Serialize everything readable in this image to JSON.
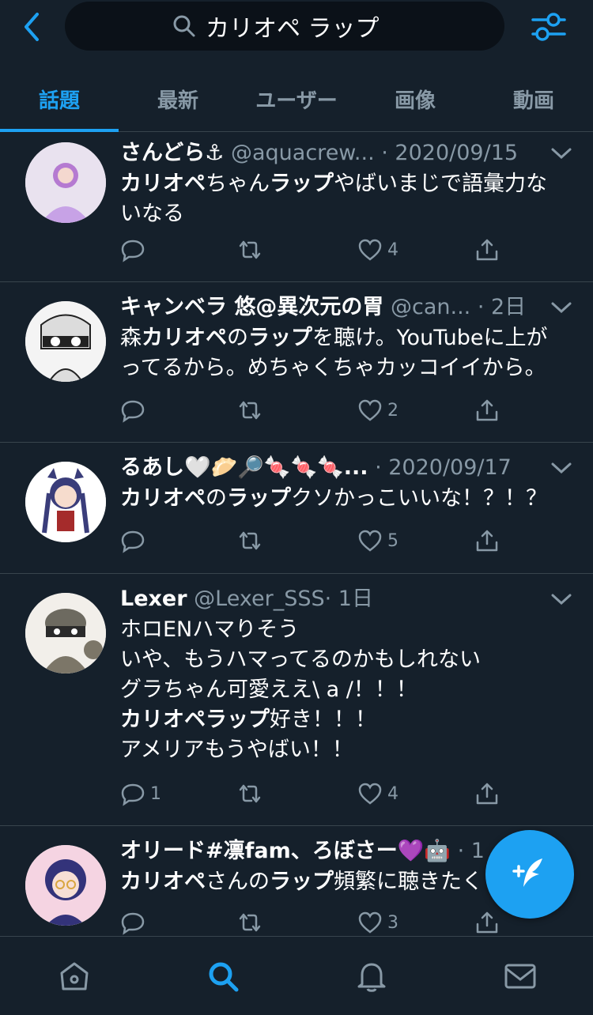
{
  "search": {
    "query": "カリオペ ラップ"
  },
  "tabs": [
    {
      "label": "話題",
      "active": true
    },
    {
      "label": "最新",
      "active": false
    },
    {
      "label": "ユーザー",
      "active": false
    },
    {
      "label": "画像",
      "active": false
    },
    {
      "label": "動画",
      "active": false
    }
  ],
  "tweets": [
    {
      "name": "さんどら⚓",
      "handle": "@aquacrew...",
      "date": "· 2020/09/15",
      "lines": [
        [
          {
            "b": "カリオペ"
          },
          {
            "t": "ちゃん"
          },
          {
            "b": "ラップ"
          },
          {
            "t": "やばいまじで語彙力な"
          }
        ],
        [
          {
            "t": "いなる"
          }
        ]
      ],
      "replies": "",
      "likes": "4"
    },
    {
      "name": "キャンベラ 悠@異次元の胃",
      "handle": "@can...",
      "date": "· 2日",
      "lines": [
        [
          {
            "t": "森"
          },
          {
            "b": "カリオペ"
          },
          {
            "t": "の"
          },
          {
            "b": "ラップ"
          },
          {
            "t": "を聴け。YouTubeに上が"
          }
        ],
        [
          {
            "t": "ってるから。めちゃくちゃカッコイイから。"
          }
        ]
      ],
      "replies": "",
      "likes": "2"
    },
    {
      "name": "るあし🤍🥟🔎🍬🍬🍬...",
      "handle": "",
      "date": "· 2020/09/17",
      "lines": [
        [
          {
            "b": "カリオペ"
          },
          {
            "t": "の"
          },
          {
            "b": "ラップ"
          },
          {
            "t": "クソかっこいいな！？！？"
          }
        ]
      ],
      "replies": "",
      "likes": "5"
    },
    {
      "name": "Lexer",
      "handle": "@Lexer_SSS",
      "date": "· 1日",
      "lines": [
        [
          {
            "t": "ホロENハマりそう"
          }
        ],
        [
          {
            "t": "いや、もうハマってるのかもしれない"
          }
        ],
        [
          {
            "t": "グラちゃん可愛ええ\\ a /！！！"
          }
        ],
        [
          {
            "b": "カリオペラップ"
          },
          {
            "t": "好き！！！"
          }
        ],
        [
          {
            "t": "アメリアもうやばい！！"
          }
        ]
      ],
      "replies": "1",
      "likes": "4"
    },
    {
      "name": "オリード#凛fam、ろぼさー💜🤖",
      "handle": "",
      "date": "· 1",
      "lines": [
        [
          {
            "b": "カリオペ"
          },
          {
            "t": "さんの"
          },
          {
            "b": "ラップ"
          },
          {
            "t": "頻繁に聴きたく"
          }
        ]
      ],
      "replies": "",
      "likes": "3"
    }
  ],
  "colors": {
    "accent": "#1da1f2",
    "background": "#15202b",
    "muted": "#8899a6"
  },
  "icons": [
    "back-icon",
    "search-icon",
    "filter-icon",
    "reply-icon",
    "retweet-icon",
    "like-icon",
    "share-icon",
    "compose-icon",
    "home-icon",
    "notifications-icon",
    "messages-icon"
  ]
}
